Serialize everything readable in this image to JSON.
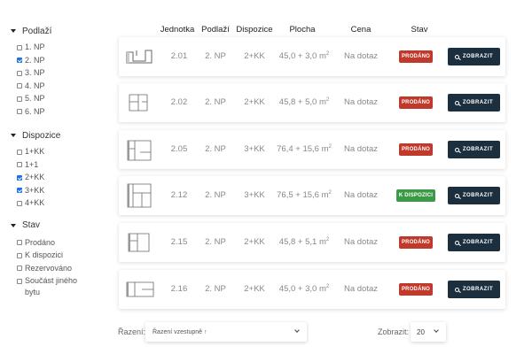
{
  "filters": [
    {
      "title": "Podlaží",
      "options": [
        {
          "label": "1. NP",
          "checked": false
        },
        {
          "label": "2. NP",
          "checked": true
        },
        {
          "label": "3. NP",
          "checked": false
        },
        {
          "label": "4. NP",
          "checked": false
        },
        {
          "label": "5. NP",
          "checked": false
        },
        {
          "label": "6. NP",
          "checked": false
        }
      ]
    },
    {
      "title": "Dispozice",
      "options": [
        {
          "label": "1+KK",
          "checked": false
        },
        {
          "label": "1+1",
          "checked": false
        },
        {
          "label": "2+KK",
          "checked": true
        },
        {
          "label": "3+KK",
          "checked": true
        },
        {
          "label": "4+KK",
          "checked": false
        }
      ]
    },
    {
      "title": "Stav",
      "options": [
        {
          "label": "Prodáno",
          "checked": false
        },
        {
          "label": "K dispozici",
          "checked": false
        },
        {
          "label": "Rezervováno",
          "checked": false
        },
        {
          "label": "Součást jiného bytu",
          "checked": false
        }
      ]
    }
  ],
  "columns": {
    "unit": "Jednotka",
    "floor": "Podlaží",
    "layout": "Dispozice",
    "area": "Plocha",
    "price": "Cena",
    "status": "Stav"
  },
  "units": [
    {
      "unit": "2.01",
      "floor": "2. NP",
      "layout": "2+KK",
      "area": "45,0 + 3,0 m",
      "area_unit_sup": "2",
      "price": "Na dotaz",
      "status": "PRODÁNO",
      "status_type": "sold",
      "button": "ZOBRAZIT"
    },
    {
      "unit": "2.02",
      "floor": "2. NP",
      "layout": "2+KK",
      "area": "45,8 + 5,0 m",
      "area_unit_sup": "2",
      "price": "Na dotaz",
      "status": "PRODÁNO",
      "status_type": "sold",
      "button": "ZOBRAZIT"
    },
    {
      "unit": "2.05",
      "floor": "2. NP",
      "layout": "3+KK",
      "area": "76,4 + 15,6 m",
      "area_unit_sup": "2",
      "price": "Na dotaz",
      "status": "PRODÁNO",
      "status_type": "sold",
      "button": "ZOBRAZIT"
    },
    {
      "unit": "2.12",
      "floor": "2. NP",
      "layout": "3+KK",
      "area": "76,5 + 15,6 m",
      "area_unit_sup": "2",
      "price": "Na dotaz",
      "status": "K DISPOZICI",
      "status_type": "available",
      "button": "ZOBRAZIT"
    },
    {
      "unit": "2.15",
      "floor": "2. NP",
      "layout": "2+KK",
      "area": "45,8 + 5,1 m",
      "area_unit_sup": "2",
      "price": "Na dotaz",
      "status": "PRODÁNO",
      "status_type": "sold",
      "button": "ZOBRAZIT"
    },
    {
      "unit": "2.16",
      "floor": "2. NP",
      "layout": "2+KK",
      "area": "45,0 + 3,0 m",
      "area_unit_sup": "2",
      "price": "Na dotaz",
      "status": "PRODÁNO",
      "status_type": "sold",
      "button": "ZOBRAZIT"
    }
  ],
  "sort": {
    "label": "Řazení:",
    "value": "Řazení vzestupně ↑"
  },
  "show": {
    "label": "Zobrazit:",
    "value": "20"
  },
  "colors": {
    "sold": "#c0392b",
    "available": "#3a9a45",
    "button": "#1b2f3f",
    "checkbox_checked": "#1a73e8"
  },
  "icons": {
    "filter_caret": "caret-down-icon",
    "button": "search-icon",
    "select": "chevron-down-icon",
    "thumbnail": "floor-plan-thumbnail"
  }
}
